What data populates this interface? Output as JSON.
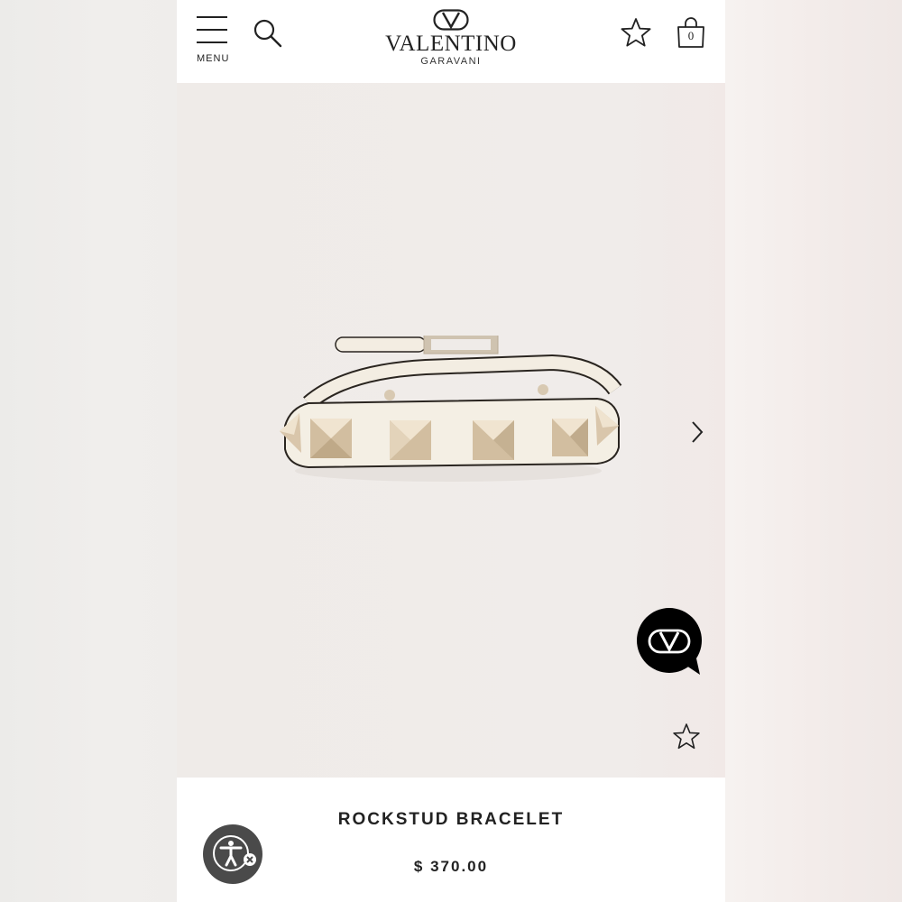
{
  "header": {
    "menu_label": "MENU",
    "brand_name": "VALENTINO",
    "brand_sub": "GARAVANI",
    "bag_count": "0"
  },
  "product": {
    "name": "ROCKSTUD BRACELET",
    "price": "$ 370.00"
  },
  "icons": {
    "menu": "hamburger-menu-icon",
    "search": "search-icon",
    "wishlist": "star-outline-icon",
    "bag": "shopping-bag-icon",
    "next": "chevron-right-icon",
    "chat": "valentino-v-logo-chat-icon",
    "favorite": "star-outline-icon",
    "accessibility": "accessibility-person-icon"
  },
  "colors": {
    "text": "#222222",
    "gallery_bg": "#efebe8",
    "chat_bg": "#000000",
    "a11y_bg": "#4a4a4a"
  }
}
